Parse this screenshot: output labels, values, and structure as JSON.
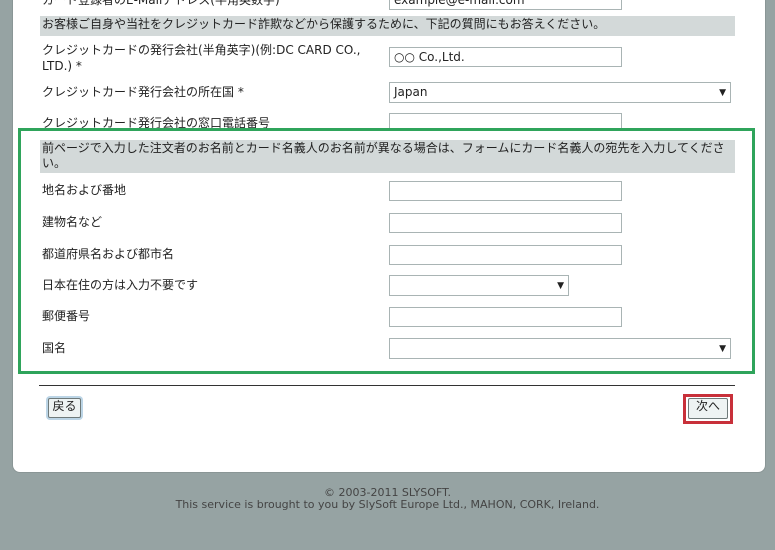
{
  "top_row": {
    "label": "カード登録者のE-Mailアドレス(半角英数字)",
    "value": "example@e-mail.com"
  },
  "notice": "お客様ご自身や当社をクレジットカード詐欺などから保護するために、下記の質問にもお答えください。",
  "card_company": {
    "label_line1": "クレジットカードの発行会社(半角英字)(例:DC CARD CO.,",
    "label_line2": "LTD.) *",
    "value": "○○ Co.,Ltd."
  },
  "issuer_country": {
    "label": "クレジットカード発行会社の所在国 *",
    "selected": "Japan"
  },
  "issuer_phone": {
    "label": "クレジットカード発行会社の窓口電話番号",
    "value": ""
  },
  "cardholder_section": {
    "header_line1": "前ページで入力した注文者のお名前とカード名義人のお名前が異なる場合は、フォームにカード名義人の宛先を入力してくださ",
    "header_line2": "い。",
    "address": {
      "label": "地名および番地",
      "value": ""
    },
    "building": {
      "label": "建物名など",
      "value": ""
    },
    "city": {
      "label": "都道府県名および都市名",
      "value": ""
    },
    "prefecture": {
      "label": "日本在住の方は入力不要です",
      "selected": ""
    },
    "postal": {
      "label": "郵便番号",
      "value": ""
    },
    "country": {
      "label": "国名",
      "selected": ""
    }
  },
  "buttons": {
    "back": "戻る",
    "next": "次へ"
  },
  "footer": {
    "copyright": "© 2003-2011 SLYSOFT.",
    "line2": "This service is brought to you by SlySoft Europe Ltd., MAHON, CORK, Ireland."
  },
  "colors": {
    "page_bg": "#96a3a3",
    "band_bg": "#d3d9d9",
    "highlight_green": "#2fa45b",
    "highlight_red": "#c8303a"
  }
}
